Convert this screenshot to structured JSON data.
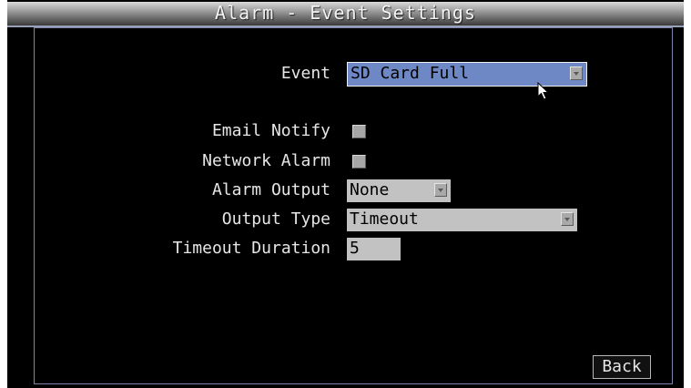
{
  "window": {
    "title": "Alarm - Event Settings"
  },
  "form": {
    "event": {
      "label": "Event",
      "value": "SD Card Full"
    },
    "email_notify": {
      "label": "Email Notify",
      "checked": false
    },
    "network_alarm": {
      "label": "Network Alarm",
      "checked": false
    },
    "alarm_output": {
      "label": "Alarm Output",
      "value": "None"
    },
    "output_type": {
      "label": "Output Type",
      "value": "Timeout"
    },
    "timeout_duration": {
      "label": "Timeout Duration",
      "value": "5"
    }
  },
  "buttons": {
    "back_label": "Back"
  },
  "colors": {
    "background": "#000000",
    "selected_field": "#6d88c4",
    "field": "#c2c2c2",
    "text": "#e6e6e6",
    "panel_border": "#7f86ad"
  },
  "icons": {
    "pointer": "mouse-pointer-icon",
    "dropdown": "chevron-down-icon"
  }
}
